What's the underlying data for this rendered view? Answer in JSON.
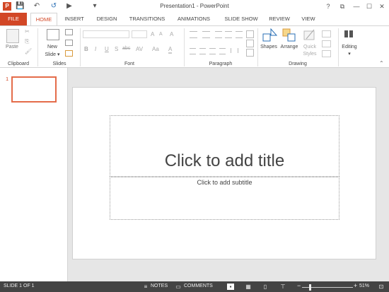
{
  "titlebar": {
    "app_icon": "P",
    "title": "Presentation1 - PowerPoint",
    "help": "?",
    "ribbon_options": "⧉",
    "minimize": "—",
    "maximize": "☐",
    "close": "✕"
  },
  "qat": {
    "save": "💾",
    "undo": "↶",
    "redo": "↺",
    "start": "▶",
    "customize": "▾"
  },
  "tabs": {
    "file": "FILE",
    "home": "HOME",
    "insert": "INSERT",
    "design": "DESIGN",
    "transitions": "TRANSITIONS",
    "animations": "ANIMATIONS",
    "slideshow": "SLIDE SHOW",
    "review": "REVIEW",
    "view": "VIEW"
  },
  "ribbon": {
    "clipboard": {
      "label": "Clipboard",
      "paste": "Paste",
      "cut": "✂",
      "copy": "⎘",
      "painter": "🖌"
    },
    "slides": {
      "label": "Slides",
      "new_slide": "New",
      "new_slide2": "Slide ▾"
    },
    "font": {
      "label": "Font",
      "bold": "B",
      "italic": "I",
      "underline": "U",
      "strike": "S",
      "shadow": "abc",
      "spacing": "AV",
      "case": "Aa",
      "color": "A",
      "grow": "A",
      "shrink": "A",
      "clear": "A"
    },
    "paragraph": {
      "label": "Paragraph"
    },
    "drawing": {
      "label": "Drawing",
      "shapes": "Shapes",
      "arrange": "Arrange",
      "quick1": "Quick",
      "quick2": "Styles"
    },
    "editing": {
      "label": "Editing"
    }
  },
  "slides_panel": {
    "thumb_number": "1"
  },
  "slide": {
    "title_placeholder": "Click to add title",
    "subtitle_placeholder": "Click to add subtitle"
  },
  "status": {
    "slide_info": "SLIDE 1 OF 1",
    "notes": "NOTES",
    "comments": "COMMENTS",
    "zoom_minus": "−",
    "zoom_plus": "+",
    "zoom": "51%"
  }
}
